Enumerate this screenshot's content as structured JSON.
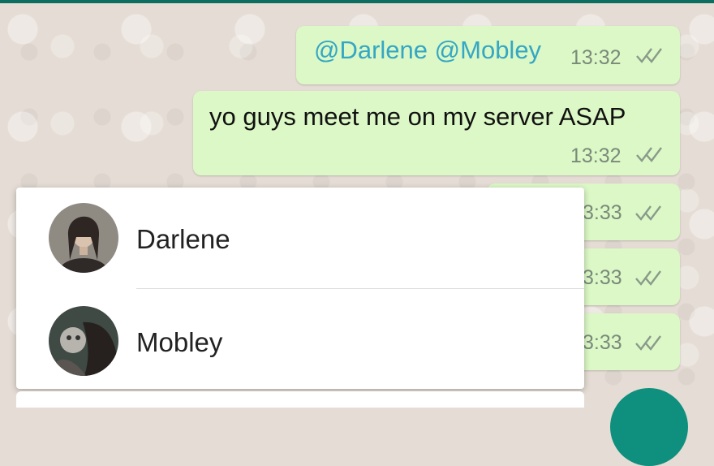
{
  "messages": [
    {
      "mention1": "@Darlene",
      "mention2": "@Mobley",
      "time": "13:32"
    },
    {
      "text": "yo guys meet me on my server ASAP",
      "time": "13:32"
    },
    {
      "time": "3:33"
    },
    {
      "time": "3:33"
    },
    {
      "time": "3:33"
    }
  ],
  "mention_suggestions": [
    {
      "name": "Darlene"
    },
    {
      "name": "Mobley"
    }
  ],
  "colors": {
    "outgoing_bubble": "#dcf8c6",
    "mention": "#34a7c4",
    "header": "#0b6e60",
    "fab": "#0f8f7d"
  }
}
